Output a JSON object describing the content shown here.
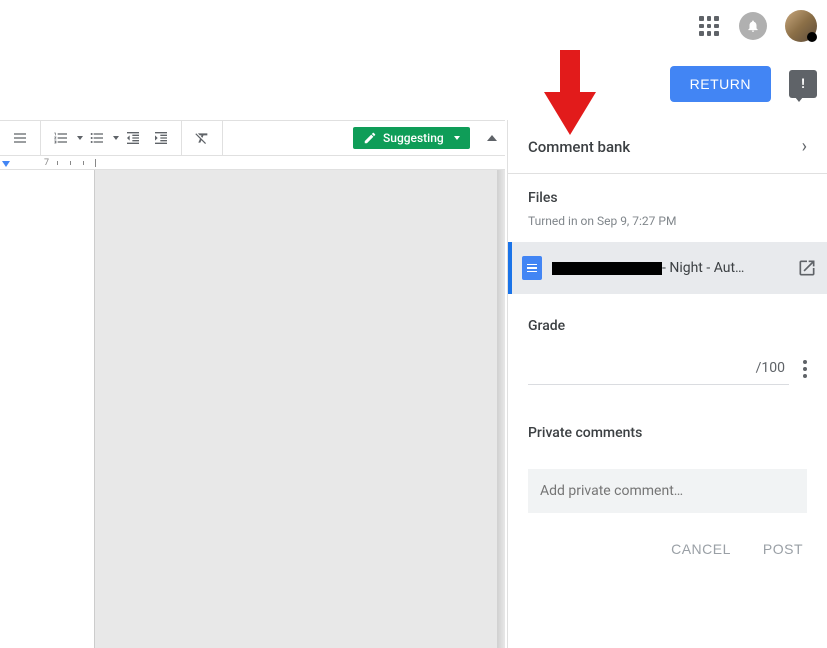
{
  "header": {
    "return_label": "RETURN"
  },
  "toolbar": {
    "suggesting_label": "Suggesting"
  },
  "ruler": {
    "mark_7": "7"
  },
  "sidebar": {
    "comment_bank": {
      "title": "Comment bank"
    },
    "files": {
      "title": "Files",
      "turned_in": "Turned in on Sep 9, 7:27 PM",
      "file_suffix": " - Night - Aut…"
    },
    "grade": {
      "title": "Grade",
      "max": "/100"
    },
    "private_comments": {
      "title": "Private comments",
      "placeholder": "Add private comment…",
      "cancel_label": "CANCEL",
      "post_label": "POST"
    }
  },
  "annotation": {
    "arrow_color": "#e21b1b"
  }
}
